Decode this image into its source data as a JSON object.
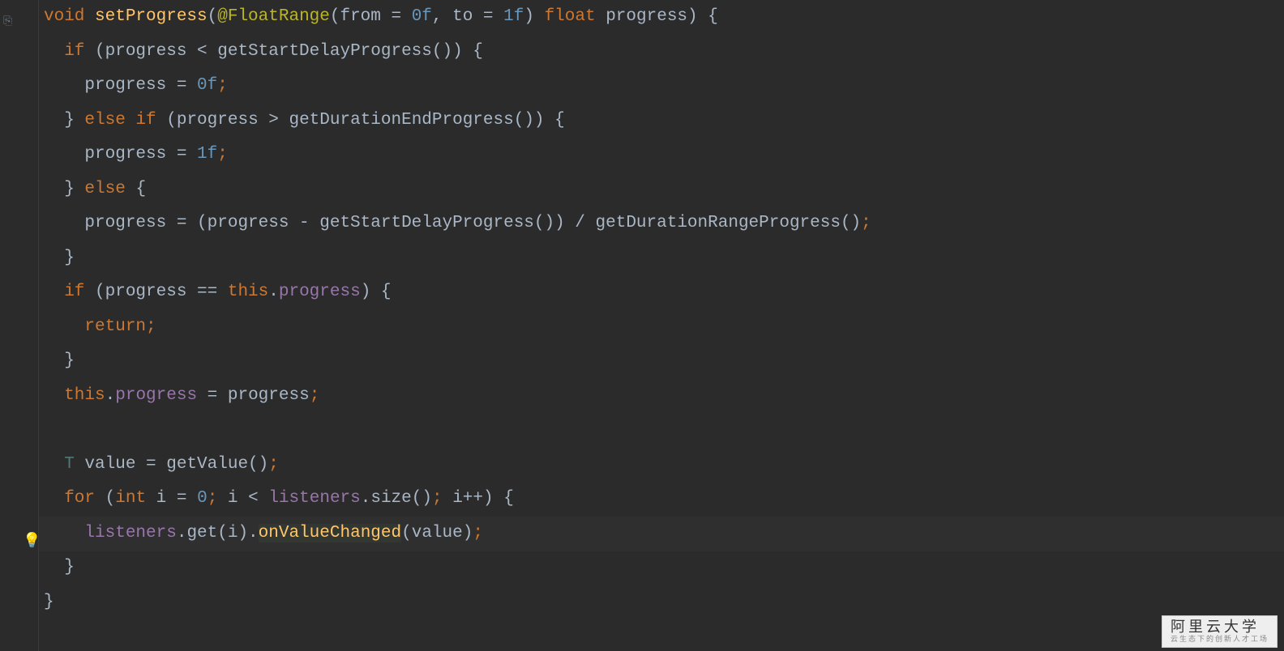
{
  "code": {
    "tokens": [
      [
        {
          "t": "void ",
          "c": "kw"
        },
        {
          "t": "setProgress",
          "c": "method"
        },
        {
          "t": "(",
          "c": "punct"
        },
        {
          "t": "@FloatRange",
          "c": "annotation"
        },
        {
          "t": "(from = ",
          "c": "plain"
        },
        {
          "t": "0f",
          "c": "param"
        },
        {
          "t": ", to = ",
          "c": "plain"
        },
        {
          "t": "1f",
          "c": "param"
        },
        {
          "t": ") ",
          "c": "plain"
        },
        {
          "t": "float ",
          "c": "kw"
        },
        {
          "t": "progress) {",
          "c": "plain"
        }
      ],
      [
        {
          "t": "  if ",
          "c": "kw"
        },
        {
          "t": "(progress < getStartDelayProgress()) {",
          "c": "plain"
        }
      ],
      [
        {
          "t": "    progress = ",
          "c": "plain"
        },
        {
          "t": "0f",
          "c": "param"
        },
        {
          "t": ";",
          "c": "kw"
        }
      ],
      [
        {
          "t": "  } ",
          "c": "plain"
        },
        {
          "t": "else if ",
          "c": "kw"
        },
        {
          "t": "(progress > getDurationEndProgress()) {",
          "c": "plain"
        }
      ],
      [
        {
          "t": "    progress = ",
          "c": "plain"
        },
        {
          "t": "1f",
          "c": "param"
        },
        {
          "t": ";",
          "c": "kw"
        }
      ],
      [
        {
          "t": "  } ",
          "c": "plain"
        },
        {
          "t": "else ",
          "c": "kw"
        },
        {
          "t": "{",
          "c": "plain"
        }
      ],
      [
        {
          "t": "    progress = (progress - getStartDelayProgress()) / getDurationRangeProgress()",
          "c": "plain"
        },
        {
          "t": ";",
          "c": "kw"
        }
      ],
      [
        {
          "t": "  }",
          "c": "plain"
        }
      ],
      [
        {
          "t": "  if ",
          "c": "kw"
        },
        {
          "t": "(progress == ",
          "c": "plain"
        },
        {
          "t": "this",
          "c": "kw"
        },
        {
          "t": ".",
          "c": "plain"
        },
        {
          "t": "progress",
          "c": "field"
        },
        {
          "t": ") {",
          "c": "plain"
        }
      ],
      [
        {
          "t": "    return;",
          "c": "kw"
        }
      ],
      [
        {
          "t": "  }",
          "c": "plain"
        }
      ],
      [
        {
          "t": "  this",
          "c": "kw"
        },
        {
          "t": ".",
          "c": "plain"
        },
        {
          "t": "progress",
          "c": "field"
        },
        {
          "t": " = progress",
          "c": "plain"
        },
        {
          "t": ";",
          "c": "kw"
        }
      ],
      [
        {
          "t": "",
          "c": "plain"
        }
      ],
      [
        {
          "t": "  T",
          "c": "generic"
        },
        {
          "t": " value = getValue()",
          "c": "plain"
        },
        {
          "t": ";",
          "c": "kw"
        }
      ],
      [
        {
          "t": "  for ",
          "c": "kw"
        },
        {
          "t": "(",
          "c": "plain"
        },
        {
          "t": "int ",
          "c": "kw"
        },
        {
          "t": "i = ",
          "c": "plain"
        },
        {
          "t": "0",
          "c": "param"
        },
        {
          "t": "; ",
          "c": "kw"
        },
        {
          "t": "i < ",
          "c": "plain"
        },
        {
          "t": "listeners",
          "c": "field"
        },
        {
          "t": ".size()",
          "c": "plain"
        },
        {
          "t": "; ",
          "c": "kw"
        },
        {
          "t": "i++) {",
          "c": "plain"
        }
      ],
      [
        {
          "t": "    ",
          "c": "plain"
        },
        {
          "t": "listeners",
          "c": "field"
        },
        {
          "t": ".get(i).",
          "c": "plain"
        },
        {
          "t": "onValueChanged",
          "c": "method",
          "hl": true
        },
        {
          "t": "(value)",
          "c": "plain"
        },
        {
          "t": ";",
          "c": "kw"
        }
      ],
      [
        {
          "t": "  }",
          "c": "plain"
        }
      ],
      [
        {
          "t": "}",
          "c": "plain"
        }
      ]
    ]
  },
  "gutter": {
    "override_icon": "⎘",
    "bulb_icon": "💡"
  },
  "watermark": {
    "title": "阿里云大学",
    "subtitle": "云生态下的创新人才工场"
  }
}
